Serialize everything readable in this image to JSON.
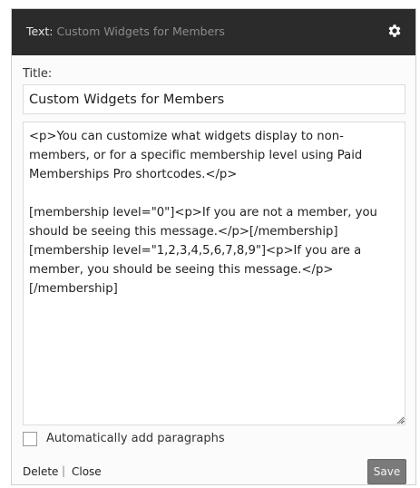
{
  "window": {
    "title_prefix": "Text:",
    "title_widget": "Custom Widgets for Members",
    "settings_icon": "gear-icon"
  },
  "form": {
    "title_label": "Title:",
    "title_value": "Custom Widgets for Members",
    "content_value": "<p>You can customize what widgets display to non-members, or for a specific membership level using Paid Memberships Pro shortcodes.</p>\n\n[membership level=\"0\"]<p>If you are not a member, you should be seeing this message.</p>[/membership]\n[membership level=\"1,2,3,4,5,6,7,8,9\"]<p>If you are a member, you should be seeing this message.</p>\n[/membership]",
    "autop_label": "Automatically add paragraphs",
    "autop_checked": false
  },
  "footer": {
    "delete_label": "Delete",
    "separator": "|",
    "close_label": "Close",
    "save_label": "Save"
  }
}
